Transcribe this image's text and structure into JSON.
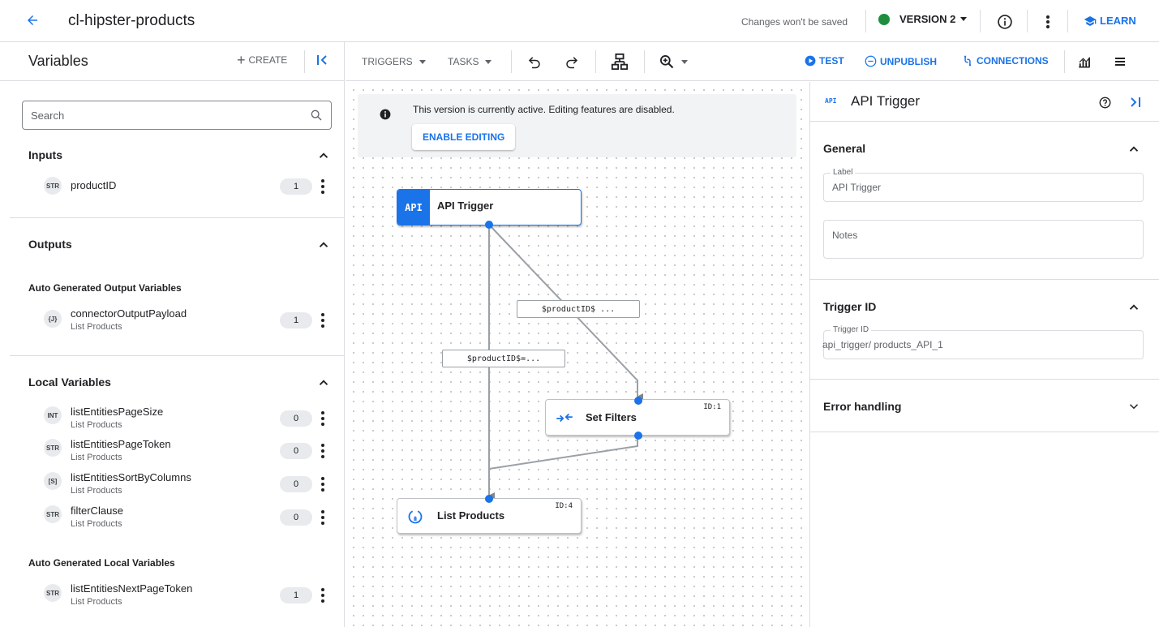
{
  "appbar": {
    "title": "cl-hipster-products",
    "save_note": "Changes won't be saved",
    "version_label": "VERSION 2",
    "version_status_color": "#1e8e3e",
    "learn_label": "LEARN"
  },
  "variables_panel": {
    "title": "Variables",
    "create_label": "CREATE",
    "search_placeholder": "Search",
    "inputs": {
      "title": "Inputs",
      "items": [
        {
          "type": "STR",
          "name": "productID",
          "count": "1"
        }
      ]
    },
    "outputs": {
      "title": "Outputs",
      "subsection": "Auto Generated Output Variables",
      "items": [
        {
          "type": "{J}",
          "name": "connectorOutputPayload",
          "sub": "List Products",
          "count": "1"
        }
      ]
    },
    "locals": {
      "title": "Local Variables",
      "items": [
        {
          "type": "INT",
          "name": "listEntitiesPageSize",
          "sub": "List Products",
          "count": "0"
        },
        {
          "type": "STR",
          "name": "listEntitiesPageToken",
          "sub": "List Products",
          "count": "0"
        },
        {
          "type": "[S]",
          "name": "listEntitiesSortByColumns",
          "sub": "List Products",
          "count": "0"
        },
        {
          "type": "STR",
          "name": "filterClause",
          "sub": "List Products",
          "count": "0"
        }
      ],
      "subsection": "Auto Generated Local Variables",
      "auto_items": [
        {
          "type": "STR",
          "name": "listEntitiesNextPageToken",
          "sub": "List Products",
          "count": "1"
        }
      ]
    }
  },
  "toolbar": {
    "triggers_label": "TRIGGERS",
    "tasks_label": "TASKS",
    "test_label": "TEST",
    "unpublish_label": "UNPUBLISH",
    "connections_label": "CONNECTIONS"
  },
  "canvas": {
    "banner_text": "This version is currently active. Editing features are disabled.",
    "enable_editing_label": "ENABLE EDITING",
    "nodes": {
      "api_trigger": {
        "badge": "API",
        "title": "API Trigger"
      },
      "set_filters": {
        "title": "Set Filters",
        "id": "ID:1"
      },
      "list_products": {
        "title": "List Products",
        "id": "ID:4"
      }
    },
    "edge_labels": {
      "to_set_filters": "$productID$ ...",
      "to_list_products": "$productID$=..."
    }
  },
  "details_panel": {
    "badge": "API",
    "title": "API Trigger",
    "general": {
      "title": "General",
      "label_field_label": "Label",
      "label_value": "API Trigger",
      "notes_placeholder": "Notes"
    },
    "trigger_id": {
      "title": "Trigger ID",
      "field_label": "Trigger ID",
      "value": "api_trigger/ products_API_1"
    },
    "error_handling": {
      "title": "Error handling"
    }
  }
}
